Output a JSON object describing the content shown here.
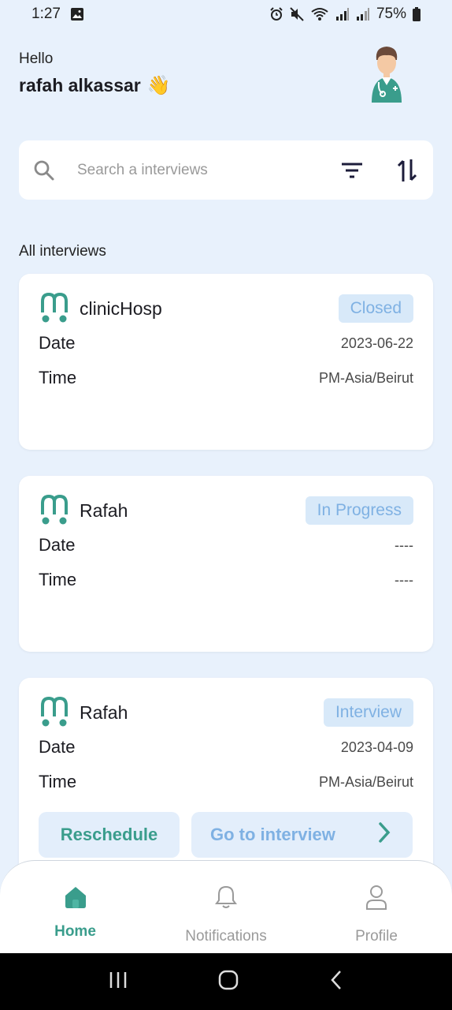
{
  "status_bar": {
    "time": "1:27",
    "battery": "75%"
  },
  "header": {
    "greeting": "Hello",
    "username": "rafah alkassar",
    "wave_emoji": "👋",
    "avatar_icon": "doctor-avatar-icon"
  },
  "search": {
    "placeholder": "Search a interviews",
    "icons": [
      "search-icon",
      "filter-icon",
      "sort-icon"
    ]
  },
  "section_title": "All interviews",
  "cards": [
    {
      "title": "clinicHosp",
      "status": "Closed",
      "date_label": "Date",
      "date": "2023-06-22",
      "time_label": "Time",
      "time": "PM-Asia/Beirut"
    },
    {
      "title": "Rafah",
      "status": "In Progress",
      "date_label": "Date",
      "date": "----",
      "time_label": "Time",
      "time": "----"
    },
    {
      "title": "Rafah",
      "status": "Interview",
      "date_label": "Date",
      "date": "2023-04-09",
      "time_label": "Time",
      "time": "PM-Asia/Beirut",
      "actions": {
        "reschedule": "Reschedule",
        "go": "Go to interview"
      }
    }
  ],
  "nav": {
    "home": "Home",
    "notifications": "Notifications",
    "profile": "Profile"
  },
  "colors": {
    "background": "#e8f1fc",
    "accent": "#3a9d8c",
    "badge_text": "#7fb1e3",
    "badge_bg": "#d8e9f9"
  }
}
